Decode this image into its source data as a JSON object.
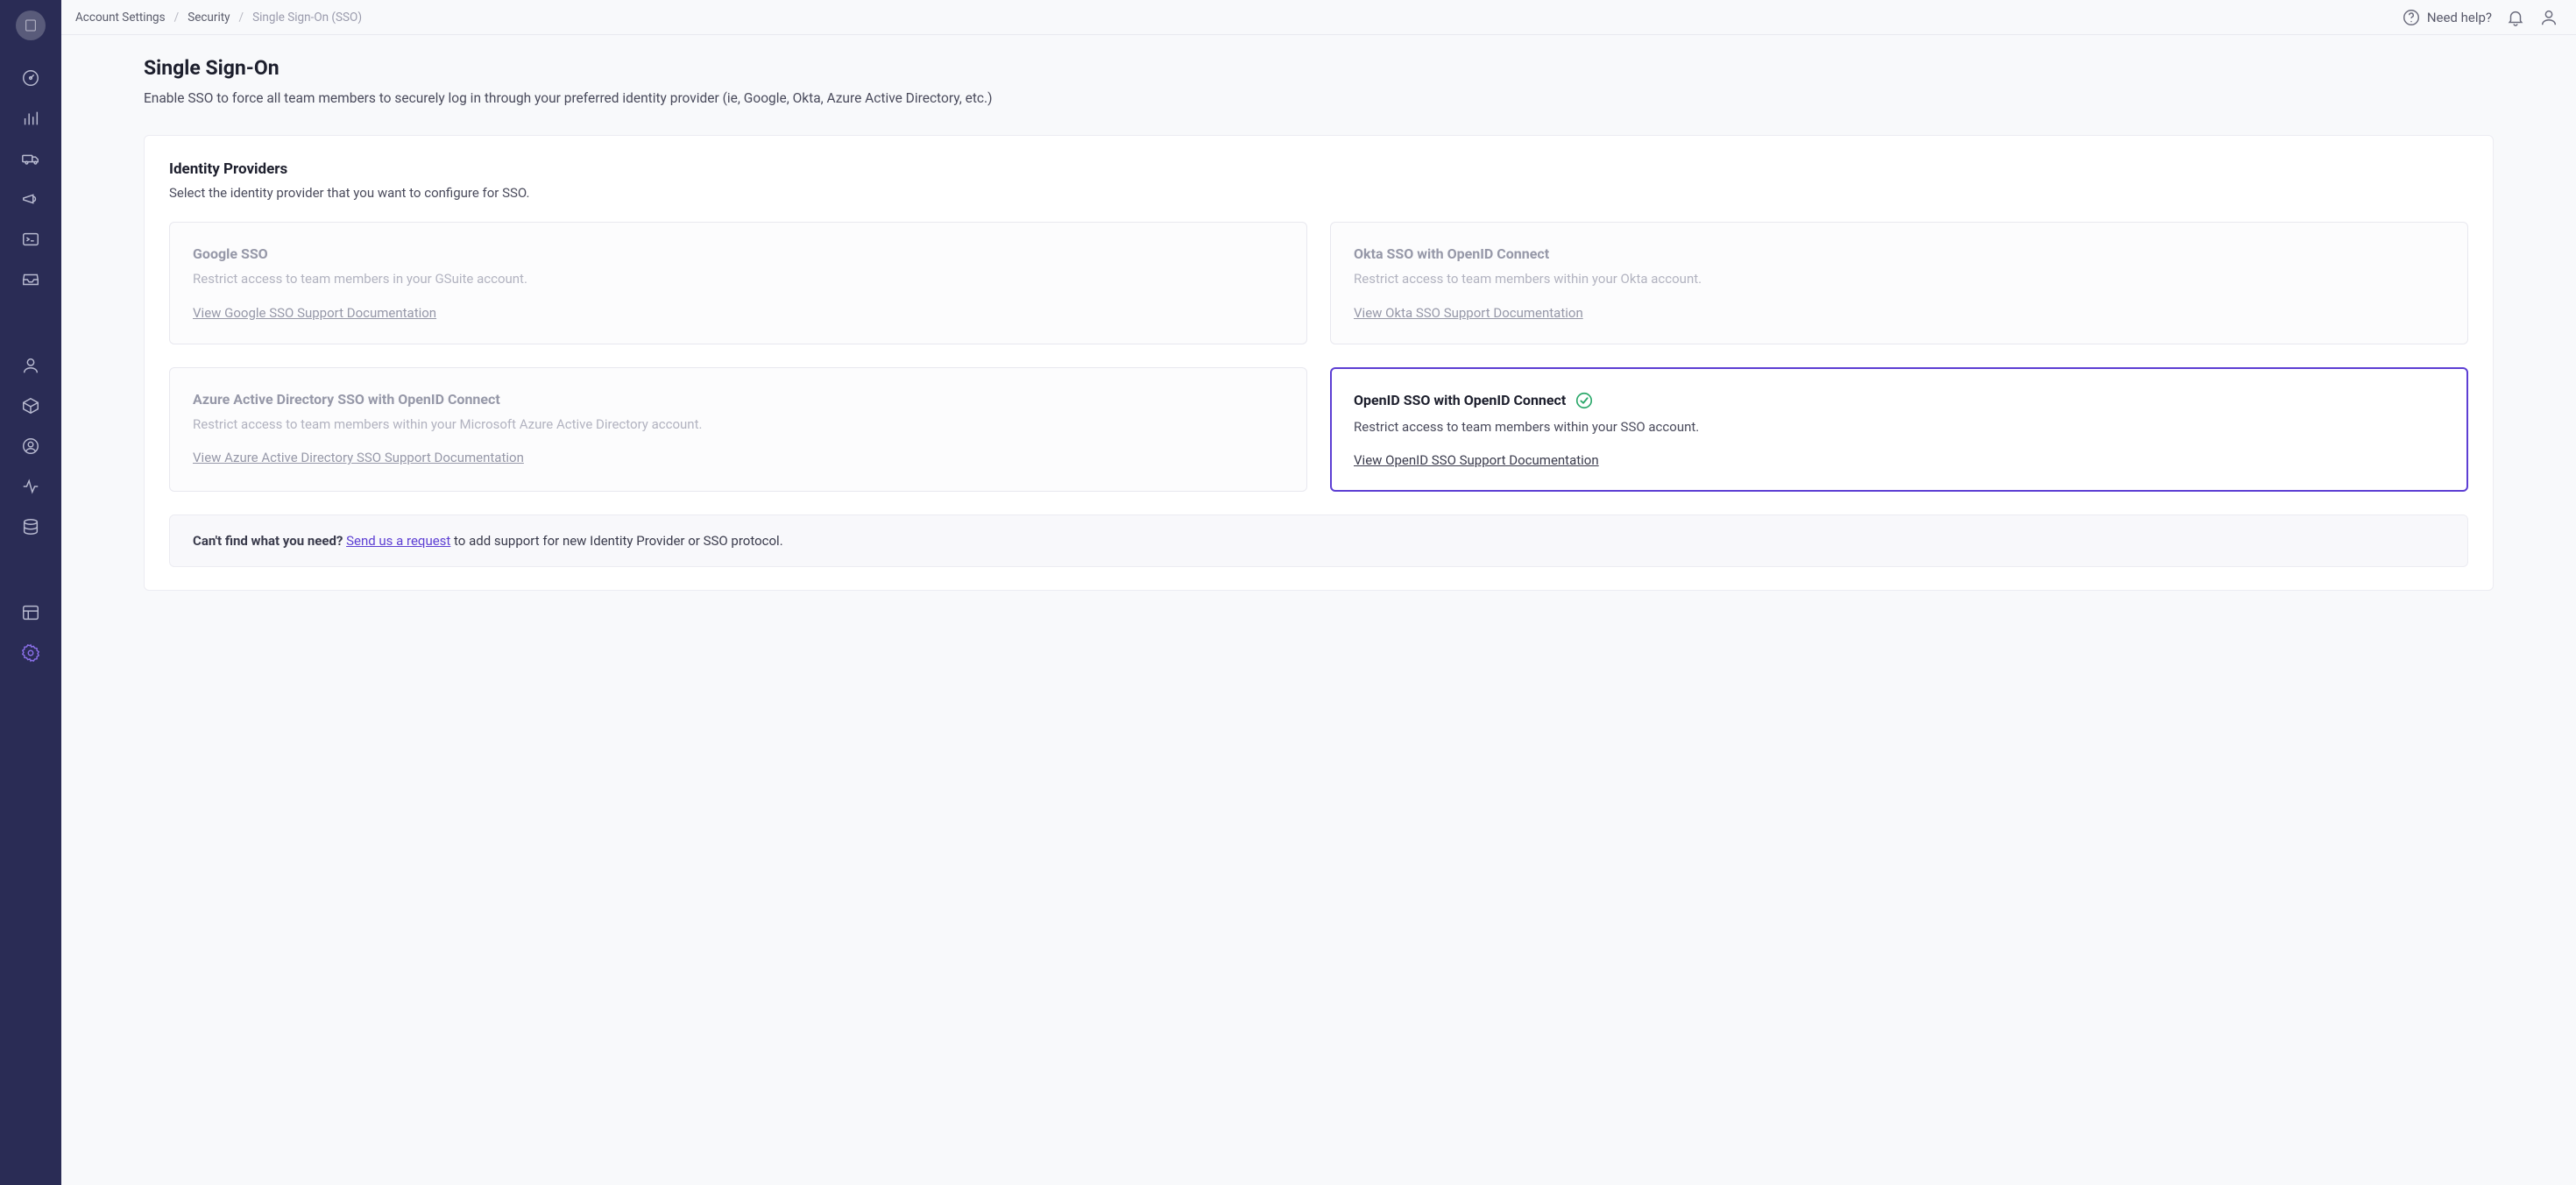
{
  "breadcrumb": {
    "items": [
      "Account Settings",
      "Security",
      "Single Sign-On (SSO)"
    ]
  },
  "topbar": {
    "help_label": "Need help?"
  },
  "page": {
    "title": "Single Sign-On",
    "subtitle": "Enable SSO to force all team members to securely log in through your preferred identity provider (ie, Google, Okta, Azure Active Directory, etc.)"
  },
  "section": {
    "title": "Identity Providers",
    "subtitle": "Select the identity provider that you want to configure for SSO."
  },
  "providers": [
    {
      "id": "google",
      "title": "Google SSO",
      "desc": "Restrict access to team members in your GSuite account.",
      "link": "View Google SSO Support Documentation",
      "selected": false
    },
    {
      "id": "okta",
      "title": "Okta SSO with OpenID Connect",
      "desc": "Restrict access to team members within your Okta account.",
      "link": "View Okta SSO Support Documentation",
      "selected": false
    },
    {
      "id": "azure",
      "title": "Azure Active Directory SSO with OpenID Connect",
      "desc": "Restrict access to team members within your Microsoft Azure Active Directory account.",
      "link": "View Azure Active Directory SSO Support Documentation",
      "selected": false
    },
    {
      "id": "openid",
      "title": "OpenID SSO with OpenID Connect",
      "desc": "Restrict access to team members within your SSO account.",
      "link": "View OpenID SSO Support Documentation",
      "selected": true
    }
  ],
  "info": {
    "strong": "Can't find what you need?",
    "link": "Send us a request",
    "rest": " to add support for new Identity Provider or SSO protocol."
  }
}
